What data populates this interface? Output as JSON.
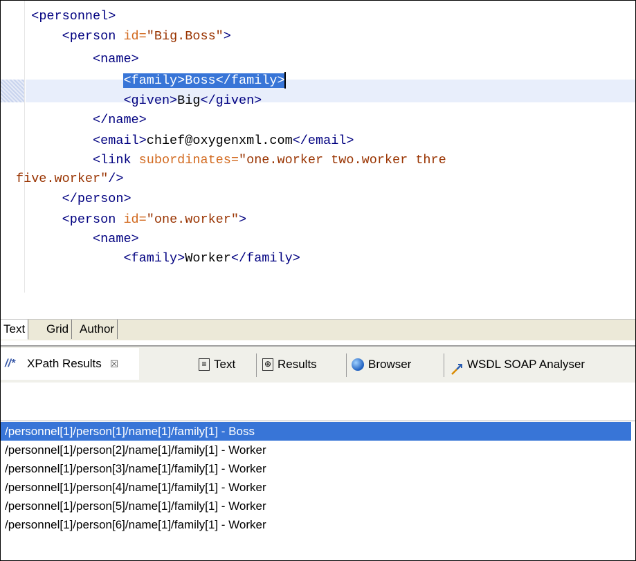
{
  "editor": {
    "lines": [
      {
        "indent": "  ",
        "parts": [
          {
            "t": "tag",
            "v": "<personnel>"
          }
        ]
      },
      {
        "indent": "      ",
        "parts": [
          {
            "t": "tag",
            "v": "<person "
          },
          {
            "t": "attr",
            "v": "id="
          },
          {
            "t": "val",
            "v": "\"Big.Boss\""
          },
          {
            "t": "tag",
            "v": ">"
          }
        ]
      },
      {
        "indent": "          ",
        "parts": [
          {
            "t": "tag",
            "v": "<name>"
          }
        ]
      },
      {
        "indent": "              ",
        "parts": [
          {
            "t": "sel",
            "v": "<family>Boss</family>"
          }
        ],
        "highlight": true
      },
      {
        "indent": "              ",
        "parts": [
          {
            "t": "tag",
            "v": "<given>"
          },
          {
            "t": "txt",
            "v": "Big"
          },
          {
            "t": "tag",
            "v": "</given>"
          }
        ]
      },
      {
        "indent": "          ",
        "parts": [
          {
            "t": "tag",
            "v": "</name>"
          }
        ]
      },
      {
        "indent": "          ",
        "parts": [
          {
            "t": "tag",
            "v": "<email>"
          },
          {
            "t": "txt",
            "v": "chief@oxygenxml.com"
          },
          {
            "t": "tag",
            "v": "</email>"
          }
        ]
      },
      {
        "indent": "          ",
        "parts": [
          {
            "t": "tag",
            "v": "<link "
          },
          {
            "t": "attr",
            "v": "subordinates="
          },
          {
            "t": "val",
            "v": "\"one.worker two.worker thre"
          }
        ]
      },
      {
        "indent": "",
        "parts": [
          {
            "t": "val",
            "v": "five.worker\""
          },
          {
            "t": "tag",
            "v": "/>"
          }
        ]
      },
      {
        "indent": "      ",
        "parts": [
          {
            "t": "tag",
            "v": "</person>"
          }
        ]
      },
      {
        "indent": "      ",
        "parts": [
          {
            "t": "tag",
            "v": "<person "
          },
          {
            "t": "attr",
            "v": "id="
          },
          {
            "t": "val",
            "v": "\"one.worker\""
          },
          {
            "t": "tag",
            "v": ">"
          }
        ]
      },
      {
        "indent": "          ",
        "parts": [
          {
            "t": "tag",
            "v": "<name>"
          }
        ]
      },
      {
        "indent": "              ",
        "parts": [
          {
            "t": "tag",
            "v": "<family>"
          },
          {
            "t": "txt",
            "v": "Worker"
          },
          {
            "t": "tag",
            "v": "</family>"
          }
        ]
      }
    ]
  },
  "editor_tabs": [
    "Text",
    "Grid",
    "Author"
  ],
  "view_tabs": {
    "xpath_results": "XPath Results",
    "close_glyph": "☒",
    "text": "Text",
    "results": "Results",
    "browser": "Browser",
    "wsdl": "WSDL SOAP Analyser"
  },
  "results": [
    "/personnel[1]/person[1]/name[1]/family[1] - Boss",
    "/personnel[1]/person[2]/name[1]/family[1] - Worker",
    "/personnel[1]/person[3]/name[1]/family[1] - Worker",
    "/personnel[1]/person[4]/name[1]/family[1] - Worker",
    "/personnel[1]/person[5]/name[1]/family[1] - Worker",
    "/personnel[1]/person[6]/name[1]/family[1] - Worker"
  ],
  "colors": {
    "tag": "#000080",
    "attribute": "#d2691e",
    "value": "#993300",
    "selection": "#3875d7"
  },
  "icons": {
    "xpath": "xpath-results-icon",
    "text_view": "text-document-icon",
    "results_view": "results-icon",
    "browser": "globe-icon",
    "wsdl": "wsdl-analyser-icon"
  }
}
